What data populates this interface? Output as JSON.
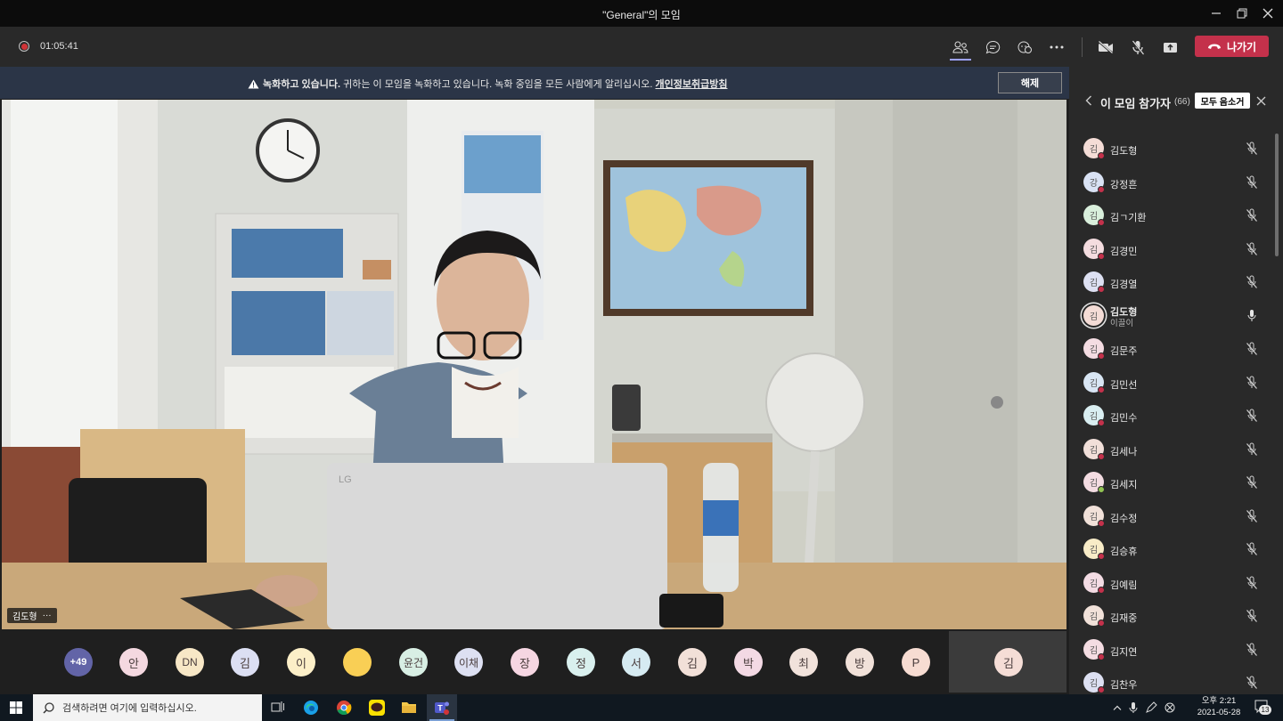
{
  "window": {
    "title": "\"General\"의 모임"
  },
  "toolbar": {
    "timer": "01:05:41",
    "leave_label": "나가기"
  },
  "banner": {
    "bold": "녹화하고 있습니다.",
    "text": " 귀하는 이 모임을 녹화하고 있습니다. 녹화 중임을 모든 사람에게 알리십시오. ",
    "link": "개인정보취급방침",
    "dismiss_label": "해제"
  },
  "video": {
    "speaker_name": "김도형",
    "more": "···"
  },
  "strip": {
    "overflow_count": "+49",
    "avatars": [
      {
        "text": "안",
        "color": "#f4d8e0"
      },
      {
        "text": "DN",
        "color": "#f7e7c6"
      },
      {
        "text": "김",
        "color": "#dcdff3"
      },
      {
        "text": "이",
        "color": "#fcefc8"
      },
      {
        "text": "",
        "color": "#f9cf55"
      },
      {
        "text": "윤건",
        "color": "#d8efe4"
      },
      {
        "text": "이채",
        "color": "#dde0f2"
      },
      {
        "text": "장",
        "color": "#f6d6e2"
      },
      {
        "text": "정",
        "color": "#d9f0ee"
      },
      {
        "text": "서",
        "color": "#d6ebf2"
      },
      {
        "text": "김",
        "color": "#f2e0d8"
      },
      {
        "text": "박",
        "color": "#f3d9e4"
      },
      {
        "text": "최",
        "color": "#f1e2db"
      },
      {
        "text": "방",
        "color": "#f1e1d9"
      },
      {
        "text": "P",
        "color": "#f7dcd2"
      }
    ],
    "active": {
      "text": "김",
      "color": "#f5ddd6"
    }
  },
  "panel": {
    "title": "이 모임 참가자",
    "count": "(66)",
    "mute_all_label": "모두 음소거",
    "participants": [
      {
        "name": "김도형",
        "initial": "김",
        "color": "#f4dcd6",
        "status": "red",
        "mic": "muted"
      },
      {
        "name": "강정흔",
        "initial": "강",
        "color": "#d9e2f4",
        "status": "red",
        "mic": "muted"
      },
      {
        "name": "김ㄱ기환",
        "initial": "김",
        "color": "#d9efdc",
        "status": "red",
        "mic": "muted"
      },
      {
        "name": "김경민",
        "initial": "김",
        "color": "#f4dcdf",
        "status": "red",
        "mic": "muted"
      },
      {
        "name": "김경열",
        "initial": "김",
        "color": "#dde0f2",
        "status": "red",
        "mic": "muted"
      },
      {
        "name": "김도형",
        "subtitle": "이끌이",
        "initial": "김",
        "color": "#f4dcd6",
        "status": "none",
        "mic": "on"
      },
      {
        "name": "김문주",
        "initial": "김",
        "color": "#f4dce2",
        "status": "red",
        "mic": "muted"
      },
      {
        "name": "김민선",
        "initial": "김",
        "color": "#d9e6f4",
        "status": "red",
        "mic": "muted"
      },
      {
        "name": "김민수",
        "initial": "김",
        "color": "#d9eef1",
        "status": "red",
        "mic": "muted"
      },
      {
        "name": "김세나",
        "initial": "김",
        "color": "#f1dfd9",
        "status": "red",
        "mic": "muted"
      },
      {
        "name": "김세지",
        "initial": "김",
        "color": "#f4dce2",
        "status": "green",
        "mic": "muted"
      },
      {
        "name": "김수정",
        "initial": "김",
        "color": "#f1e1d9",
        "status": "red",
        "mic": "muted"
      },
      {
        "name": "김승휴",
        "initial": "김",
        "color": "#f8ecc7",
        "status": "red",
        "mic": "muted"
      },
      {
        "name": "김예림",
        "initial": "김",
        "color": "#f4dce4",
        "status": "red",
        "mic": "muted"
      },
      {
        "name": "김재중",
        "initial": "김",
        "color": "#f1e1d9",
        "status": "red",
        "mic": "muted"
      },
      {
        "name": "김지연",
        "initial": "김",
        "color": "#f4dce2",
        "status": "red",
        "mic": "muted"
      },
      {
        "name": "김찬우",
        "initial": "김",
        "color": "#dde0f2",
        "status": "red",
        "mic": "muted"
      }
    ]
  },
  "taskbar": {
    "search_placeholder": "검색하려면 여기에 입력하십시오.",
    "time": "오후 2:21",
    "date": "2021-05-28",
    "notif_count": "13"
  }
}
